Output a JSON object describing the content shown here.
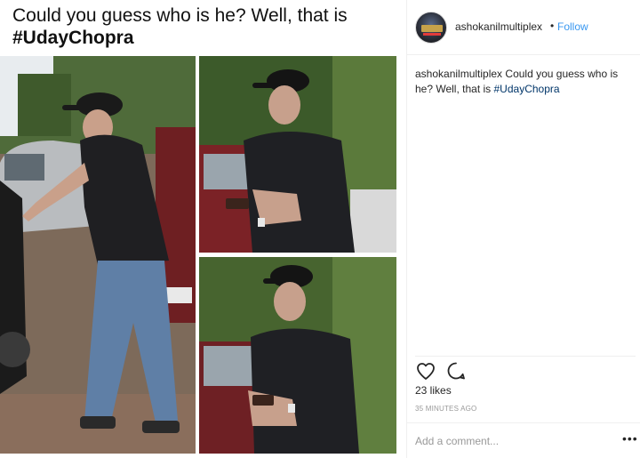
{
  "post": {
    "caption_line": "Could you guess who is he? Well, that is",
    "caption_tag": "#UdayChopra",
    "photos": [
      {
        "subject": "man in black cap and t-shirt walking past parked cars"
      },
      {
        "subject": "man in black cap holding phone near car"
      },
      {
        "subject": "man in black cap holding phone among trees"
      }
    ]
  },
  "header": {
    "username": "ashokanilmultiplex",
    "separator": "•",
    "follow_label": "Follow"
  },
  "comment": {
    "username": "ashokanilmultiplex",
    "text": "Could you guess who is he? Well, that is ",
    "hashtag": "#UdayChopra"
  },
  "actions": {
    "like_icon": "heart-icon",
    "comment_icon": "comment-icon"
  },
  "likes_text": "23 likes",
  "timestamp": "35 MINUTES AGO",
  "add_comment": {
    "placeholder": "Add a comment...",
    "more_label": "•••"
  },
  "colors": {
    "link_blue": "#3897f0",
    "hashtag_blue": "#003569",
    "text_dark": "#262626",
    "muted": "#999999"
  }
}
